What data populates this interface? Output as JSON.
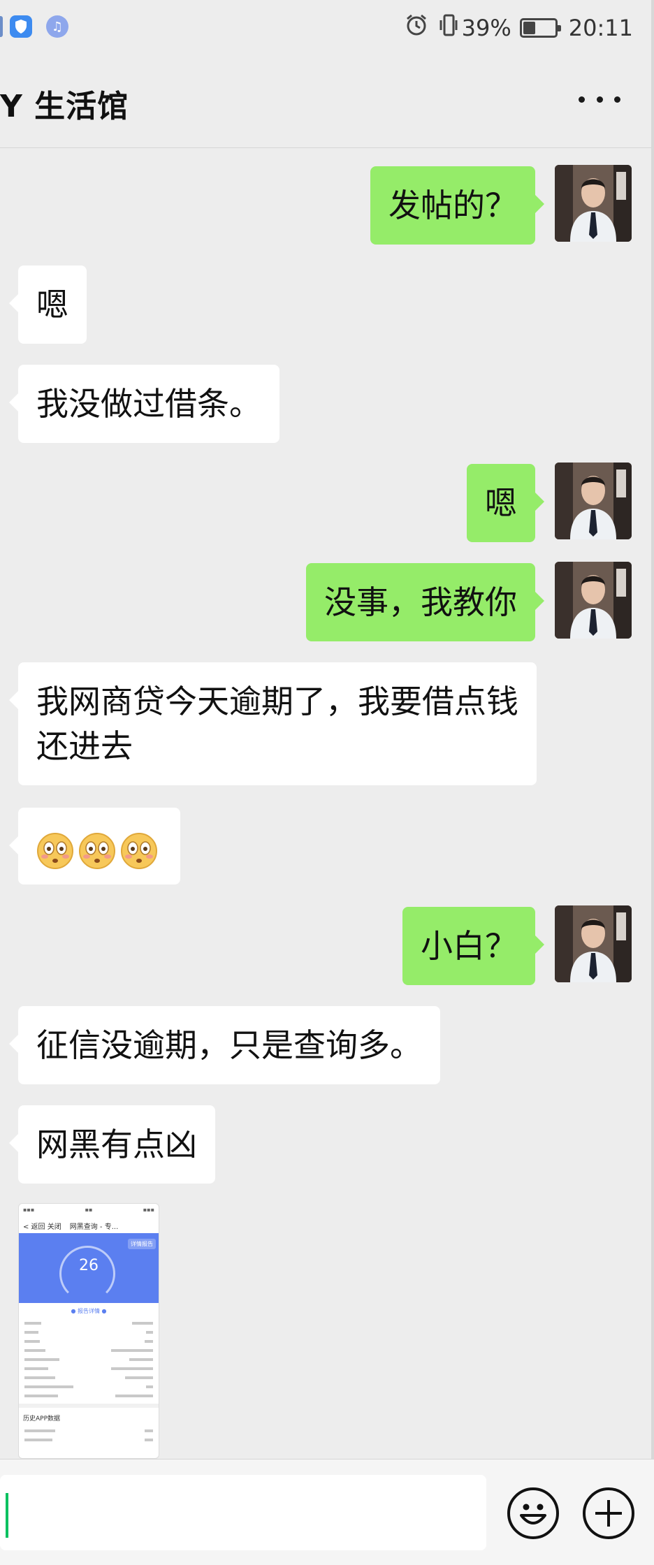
{
  "status_bar": {
    "battery_percent": "39%",
    "battery_level": 0.39,
    "time": "20:11",
    "icons": [
      "shield-app-icon",
      "music-app-icon",
      "alarm-icon",
      "vibrate-icon",
      "battery-icon"
    ]
  },
  "header": {
    "title": "Y 生活馆",
    "more_icon": "more-dots-icon"
  },
  "messages": [
    {
      "side": "out",
      "text": "发帖的？"
    },
    {
      "side": "in",
      "text": "嗯"
    },
    {
      "side": "in",
      "text": "我没做过借条。"
    },
    {
      "side": "out",
      "text": "嗯"
    },
    {
      "side": "out",
      "text": "没事，我教你"
    },
    {
      "side": "in",
      "text": "我网商贷今天逾期了，我要借点钱还进去"
    },
    {
      "side": "in",
      "text": "",
      "emoji": [
        "flushed-face",
        "flushed-face",
        "flushed-face"
      ]
    },
    {
      "side": "out",
      "text": "小白？"
    },
    {
      "side": "in",
      "text": "征信没逾期，只是查询多。"
    },
    {
      "side": "in",
      "text": "网黑有点凶"
    },
    {
      "side": "in",
      "type": "image",
      "thumbnail": {
        "nav_back": "< 返回 关闭",
        "nav_title": "网黑查询 - 专...",
        "tag": "详情报告",
        "score": "26",
        "section": "● 报告详情 ●",
        "sub_title": "历史APP数据"
      }
    }
  ],
  "input_bar": {
    "value": "",
    "emoji_icon": "emoji-face-icon",
    "plus_icon": "plus-circle-icon"
  },
  "colors": {
    "background": "#ededed",
    "outgoing_bubble": "#95ec69",
    "incoming_bubble": "#ffffff",
    "caret": "#07c160"
  }
}
